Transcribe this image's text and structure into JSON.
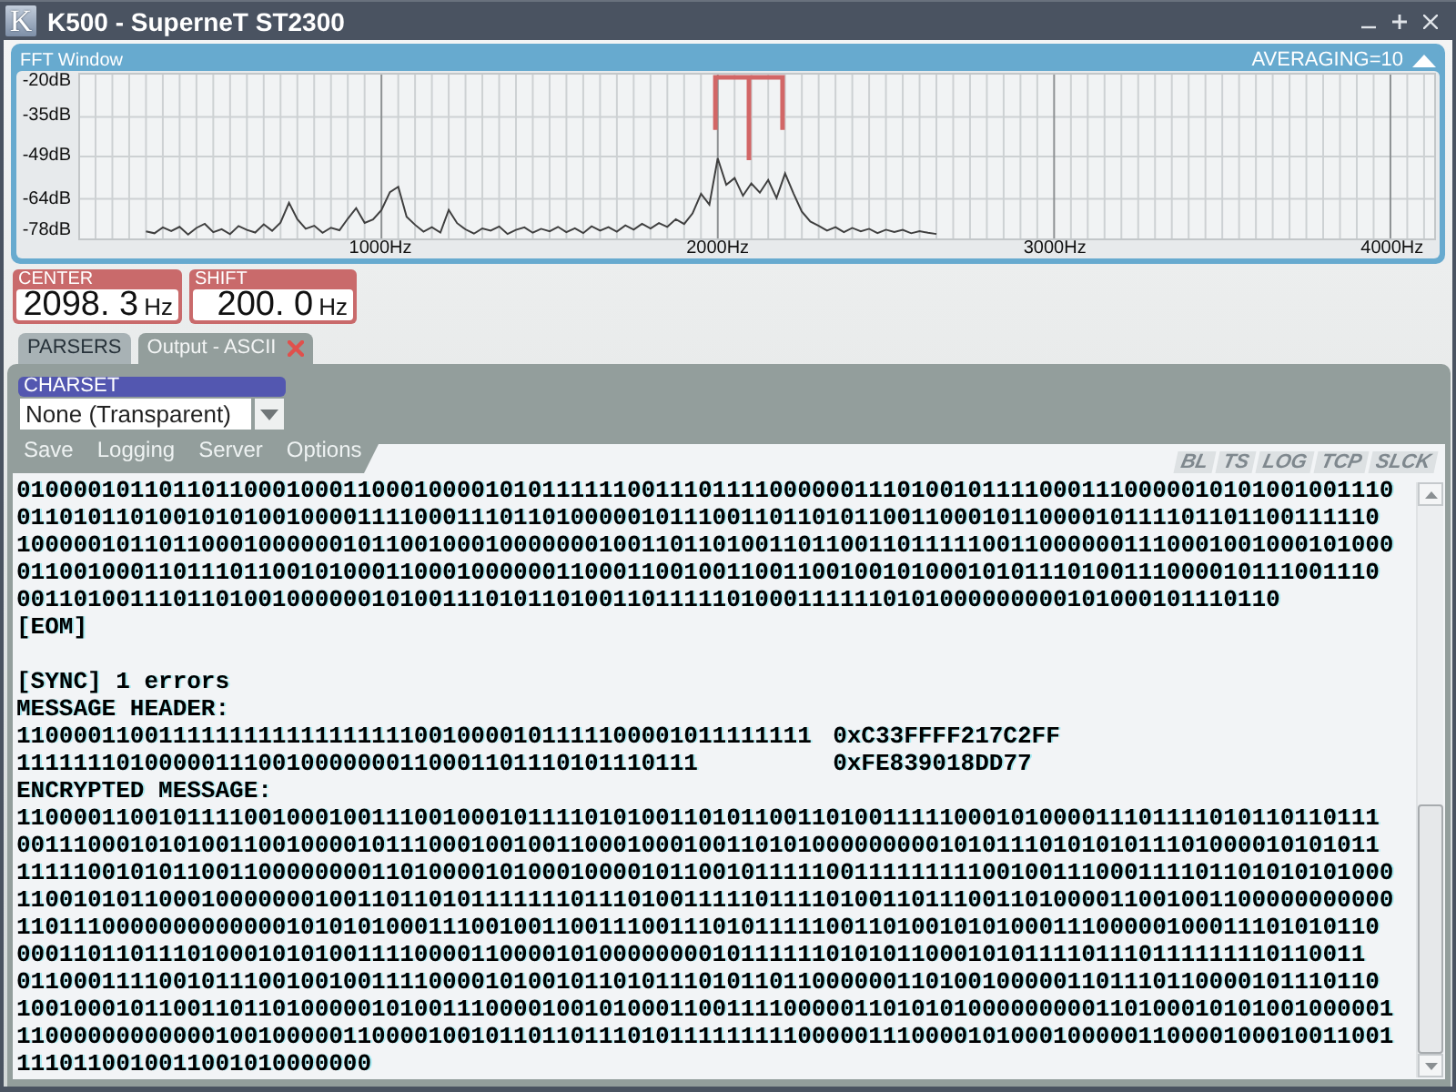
{
  "window": {
    "logo": "K",
    "title": "K500 - SuperneT ST2300"
  },
  "fft_window": {
    "title": "FFT Window",
    "averaging": "AVERAGING=10",
    "chart_data": {
      "type": "line",
      "grid": true,
      "xlim": [
        104,
        4130
      ],
      "ylim": [
        -78,
        -20
      ],
      "xticks": [
        {
          "value": 1000,
          "label": "1000Hz"
        },
        {
          "value": 2000,
          "label": "2000Hz"
        },
        {
          "value": 3000,
          "label": "3000Hz"
        },
        {
          "value": 4000,
          "label": "4000Hz"
        }
      ],
      "yticks": [
        {
          "value": -20,
          "label": "-20dB"
        },
        {
          "value": -35,
          "label": "-35dB"
        },
        {
          "value": -49,
          "label": "-49dB"
        },
        {
          "value": -64,
          "label": "-64dB"
        },
        {
          "value": -78,
          "label": "-78dB"
        }
      ],
      "x": [
        300,
        325,
        350,
        375,
        400,
        425,
        450,
        475,
        500,
        525,
        550,
        575,
        600,
        625,
        650,
        675,
        700,
        725,
        750,
        775,
        800,
        825,
        850,
        875,
        900,
        925,
        950,
        975,
        1000,
        1025,
        1050,
        1075,
        1100,
        1125,
        1150,
        1175,
        1200,
        1225,
        1250,
        1275,
        1300,
        1325,
        1350,
        1375,
        1400,
        1425,
        1450,
        1475,
        1500,
        1525,
        1550,
        1575,
        1600,
        1625,
        1650,
        1675,
        1700,
        1725,
        1750,
        1775,
        1800,
        1825,
        1850,
        1875,
        1900,
        1925,
        1950,
        1975,
        2000,
        2025,
        2050,
        2075,
        2100,
        2125,
        2150,
        2175,
        2200,
        2225,
        2250,
        2275,
        2300,
        2325,
        2350,
        2375,
        2400,
        2425,
        2450,
        2475,
        2500,
        2525,
        2550,
        2575,
        2600,
        2625,
        2650
      ],
      "series": [
        {
          "color": "#3f3f3f",
          "values": [
            -75.5,
            -76.2,
            -74.1,
            -75.4,
            -73.9,
            -76.6,
            -74.3,
            -72.8,
            -75.8,
            -74.7,
            -76.5,
            -73.6,
            -75.0,
            -75.9,
            -73.0,
            -75.3,
            -72.4,
            -65.4,
            -71.2,
            -74.6,
            -73.5,
            -76.0,
            -74.2,
            -75.1,
            -71.0,
            -67.3,
            -72.5,
            -71.3,
            -68.0,
            -61.6,
            -59.7,
            -70.4,
            -73.2,
            -75.6,
            -74.0,
            -75.9,
            -67.9,
            -72.6,
            -74.8,
            -76.3,
            -74.5,
            -75.2,
            -73.8,
            -76.4,
            -75.0,
            -74.1,
            -76.0,
            -74.6,
            -75.5,
            -73.9,
            -75.8,
            -74.4,
            -76.1,
            -73.7,
            -75.2,
            -74.0,
            -75.6,
            -73.4,
            -74.9,
            -72.8,
            -74.5,
            -72.6,
            -73.9,
            -71.2,
            -72.9,
            -69.2,
            -62.2,
            -66.0,
            -49.6,
            -59.0,
            -56.6,
            -62.9,
            -58.5,
            -61.8,
            -57.3,
            -63.7,
            -55.0,
            -62.0,
            -68.5,
            -72.0,
            -73.5,
            -75.2,
            -74.0,
            -75.8,
            -74.3,
            -75.5,
            -74.6,
            -76.1,
            -74.9,
            -75.7,
            -75.0,
            -76.2,
            -75.4,
            -76.0,
            -76.4
          ]
        }
      ]
    }
  },
  "tuning_fields": [
    {
      "label": "CENTER",
      "value": "2098. 3",
      "unit": "Hz"
    },
    {
      "label": "SHIFT",
      "value": "200. 0",
      "unit": "Hz"
    }
  ],
  "tabs": [
    {
      "label": "PARSERS",
      "selected": false,
      "closable": false
    },
    {
      "label": "Output - ASCII",
      "selected": true,
      "closable": true
    }
  ],
  "charset": {
    "label": "CHARSET",
    "value": "None (Transparent)"
  },
  "menu": [
    "Save",
    "Logging",
    "Server",
    "Options"
  ],
  "toggles": [
    {
      "label": "BL",
      "on": false
    },
    {
      "label": "TS",
      "on": false
    },
    {
      "label": "LOG",
      "on": false
    },
    {
      "label": "TCP",
      "on": false
    },
    {
      "label": "SLCK",
      "on": false
    }
  ],
  "output": [
    {
      "kind": "text",
      "text": "0100001011011011000100011000100001010111111001110111100000011101001011110001110000010101001001110"
    },
    {
      "kind": "text",
      "text": "011010110100101010010000111100011101101000001011100110110101100110001011000010111101101100111110"
    },
    {
      "kind": "text",
      "text": "1000001011011000100000010110010001000000010011011010011011001101111100110000001110001001000101000"
    },
    {
      "kind": "text",
      "text": "011001000110111011001010001100010000001100011001001100110010010100010101110100111000010111001110"
    },
    {
      "kind": "text",
      "text": "00110100111011010010000001010011101011010011011111010001111110101000000000101000101110110"
    },
    {
      "kind": "text",
      "text": "[EOM]"
    },
    {
      "kind": "gap"
    },
    {
      "kind": "text",
      "text": "[SYNC] 1 errors"
    },
    {
      "kind": "text",
      "text": "MESSAGE HEADER:"
    },
    {
      "kind": "hex",
      "bits": "11000011001111111111111111110010000101111100001011111111",
      "hex": "0xC33FFFF217C2FF"
    },
    {
      "kind": "hex",
      "bits": "111111101000001110010000000110001101110101110111",
      "hex": "0xFE839018DD77"
    },
    {
      "kind": "text",
      "text": "ENCRYPTED MESSAGE:"
    },
    {
      "kind": "text",
      "text": "110000110010111100100010011100100010111101010011010110011010011111000101000011101111010110110111"
    },
    {
      "kind": "text",
      "text": "001110001010100110010000101110001001001100010001001101010000000001010111010101011101000010101011"
    },
    {
      "kind": "text",
      "text": "1111100101011001100000000110100001010001000010110010111110011111111100100111000111101101010101000"
    },
    {
      "kind": "text",
      "text": "1100101011000100000001001101101011111110111010011111011110100110111001101000011001001100000000000"
    },
    {
      "kind": "text",
      "text": "110111000000000000010101010001110010011001110011101011111001101001010100011100000100011101010110"
    },
    {
      "kind": "text",
      "text": "00011011011101000101010011110000110000101000000001011111101010110001010111101110111111110110011"
    },
    {
      "kind": "text",
      "text": "011000111100101110010010011110000101001011010111010110110000001101001000001101110110000101110110"
    },
    {
      "kind": "text",
      "text": "1001000101100110110100000101001110000100101000110011110000011010101000000000110100010101001000001"
    },
    {
      "kind": "text",
      "text": "1100000000000010010000011000010010110110111010111111111000001110000101000100000110000100010011001"
    },
    {
      "kind": "text",
      "text": "1110110010011001010000000"
    }
  ]
}
